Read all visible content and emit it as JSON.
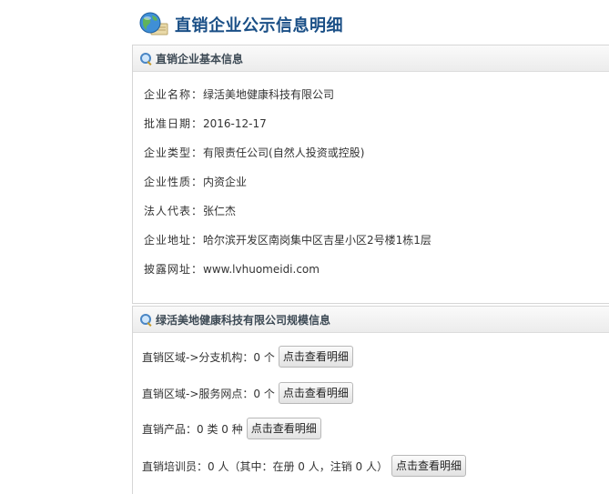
{
  "header": {
    "title": "直销企业公示信息明细",
    "icon": "globe-icon"
  },
  "basic_info": {
    "section_title": "直销企业基本信息",
    "rows": [
      {
        "label": "企业名称：",
        "value": "绿活美地健康科技有限公司"
      },
      {
        "label": "批准日期：",
        "value": "2016-12-17"
      },
      {
        "label": "企业类型：",
        "value": "有限责任公司(自然人投资或控股)"
      },
      {
        "label": "企业性质：",
        "value": "内资企业"
      },
      {
        "label": "法人代表：",
        "value": "张仁杰"
      },
      {
        "label": "企业地址：",
        "value": "哈尔滨开发区南岗集中区吉星小区2号楼1栋1层"
      },
      {
        "label": "披露网址：",
        "value": "www.lvhuomeidi.com"
      }
    ]
  },
  "scale_info": {
    "section_title": "绿活美地健康科技有限公司规模信息",
    "rows": [
      {
        "text": "直销区域->分支机构：0 个",
        "button": "点击查看明细"
      },
      {
        "text": "直销区域->服务网点：0 个",
        "button": "点击查看明细"
      },
      {
        "text": "直销产品：0 类 0 种",
        "button": "点击查看明细"
      },
      {
        "text": "直销培训员：0 人（其中：在册 0 人，注销 0 人）",
        "button": "点击查看明细"
      }
    ]
  },
  "colors": {
    "title": "#1a4f86",
    "panel_header_text": "#3d4a55"
  }
}
